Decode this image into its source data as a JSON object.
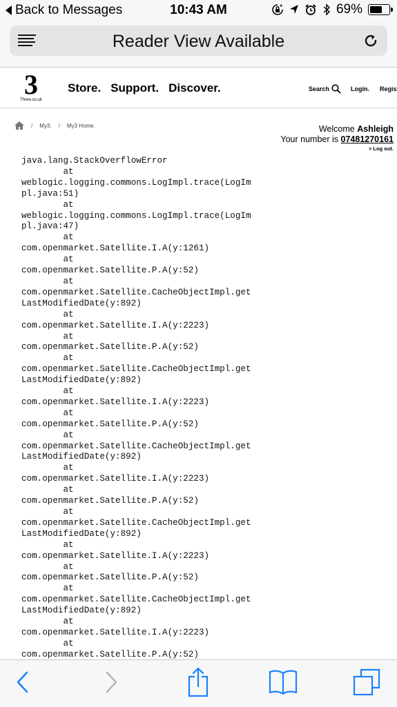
{
  "status_bar": {
    "back_label": "Back to Messages",
    "time": "10:43 AM",
    "battery_percent": "69%",
    "battery_level": 0.69,
    "icons": [
      "orientation-lock-icon",
      "location-arrow-icon",
      "alarm-icon",
      "bluetooth-icon",
      "battery-icon"
    ]
  },
  "url_bar": {
    "title": "Reader View Available",
    "icons": [
      "reader-view-icon",
      "reload-icon"
    ]
  },
  "site_header": {
    "logo_text": "3",
    "logo_subtext": "Three.co.uk",
    "nav": [
      "Store.",
      "Support.",
      "Discover."
    ],
    "search_label": "Search",
    "login_label": "Login.",
    "register_label": "Register"
  },
  "breadcrumb": {
    "items": [
      "My3.",
      "My3 Home."
    ],
    "separator": "/"
  },
  "welcome": {
    "greeting": "Welcome",
    "name": "Ashleigh",
    "number_prefix": "Your number is",
    "number": "07481270161",
    "logout": "> Log out."
  },
  "error": {
    "lines": [
      "java.lang.StackOverflowError",
      "        at",
      "weblogic.logging.commons.LogImpl.trace(LogIm",
      "pl.java:51)",
      "        at",
      "weblogic.logging.commons.LogImpl.trace(LogIm",
      "pl.java:47)",
      "        at",
      "com.openmarket.Satellite.I.A(y:1261)",
      "        at",
      "com.openmarket.Satellite.P.A(y:52)",
      "        at",
      "com.openmarket.Satellite.CacheObjectImpl.get",
      "LastModifiedDate(y:892)",
      "        at",
      "com.openmarket.Satellite.I.A(y:2223)",
      "        at",
      "com.openmarket.Satellite.P.A(y:52)",
      "        at",
      "com.openmarket.Satellite.CacheObjectImpl.get",
      "LastModifiedDate(y:892)",
      "        at",
      "com.openmarket.Satellite.I.A(y:2223)",
      "        at",
      "com.openmarket.Satellite.P.A(y:52)",
      "        at",
      "com.openmarket.Satellite.CacheObjectImpl.get",
      "LastModifiedDate(y:892)",
      "        at",
      "com.openmarket.Satellite.I.A(y:2223)",
      "        at",
      "com.openmarket.Satellite.P.A(y:52)",
      "        at",
      "com.openmarket.Satellite.CacheObjectImpl.get",
      "LastModifiedDate(y:892)",
      "        at",
      "com.openmarket.Satellite.I.A(y:2223)",
      "        at",
      "com.openmarket.Satellite.P.A(y:52)",
      "        at",
      "com.openmarket.Satellite.CacheObjectImpl.get",
      "LastModifiedDate(y:892)",
      "        at",
      "com.openmarket.Satellite.I.A(y:2223)",
      "        at",
      "com.openmarket.Satellite.P.A(y:52)"
    ]
  },
  "toolbar": {
    "icons": [
      "back-icon",
      "forward-icon",
      "share-icon",
      "bookmarks-icon",
      "tabs-icon"
    ]
  },
  "colors": {
    "ios_blue": "#1a82fb",
    "disabled_gray": "#b5b5b5",
    "chrome_bg": "#f7f7f7",
    "url_bar_bg": "#e4e4e6"
  }
}
